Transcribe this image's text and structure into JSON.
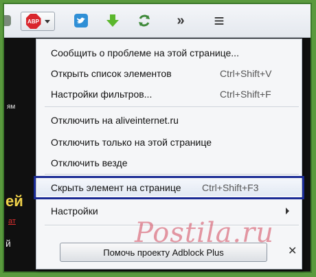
{
  "toolbar": {
    "buttons": [
      {
        "name": "abp-button",
        "badge": "ABP"
      },
      {
        "name": "twitter-button"
      },
      {
        "name": "download-button"
      },
      {
        "name": "refresh-button"
      },
      {
        "name": "overflow-button",
        "glyph": "»"
      },
      {
        "name": "main-menu-button",
        "glyph": "≡"
      }
    ]
  },
  "background": {
    "fragment1": "ям",
    "fragment2": "ей",
    "fragment3": "ат",
    "fragment4": "й"
  },
  "menu": {
    "items": [
      {
        "label": "Сообщить о проблеме на этой странице...",
        "shortcut": ""
      },
      {
        "label": "Открыть список элементов",
        "shortcut": "Ctrl+Shift+V"
      },
      {
        "label": "Настройки фильтров...",
        "shortcut": "Ctrl+Shift+F"
      },
      {
        "label": "Отключить на aliveinternet.ru",
        "shortcut": ""
      },
      {
        "label": "Отключить только на этой странице",
        "shortcut": ""
      },
      {
        "label": "Отключить везде",
        "shortcut": ""
      },
      {
        "label": "Скрыть элемент на странице",
        "shortcut": "Ctrl+Shift+F3"
      },
      {
        "label": "Настройки",
        "shortcut": ""
      }
    ],
    "help_button": "Помочь проекту Adblock Plus",
    "close_glyph": "✕"
  },
  "watermark": "Postila.ru",
  "colors": {
    "highlight_outline": "#1a2a94",
    "abp_red": "#d9262c",
    "frame_green": "#5a9a3e"
  }
}
